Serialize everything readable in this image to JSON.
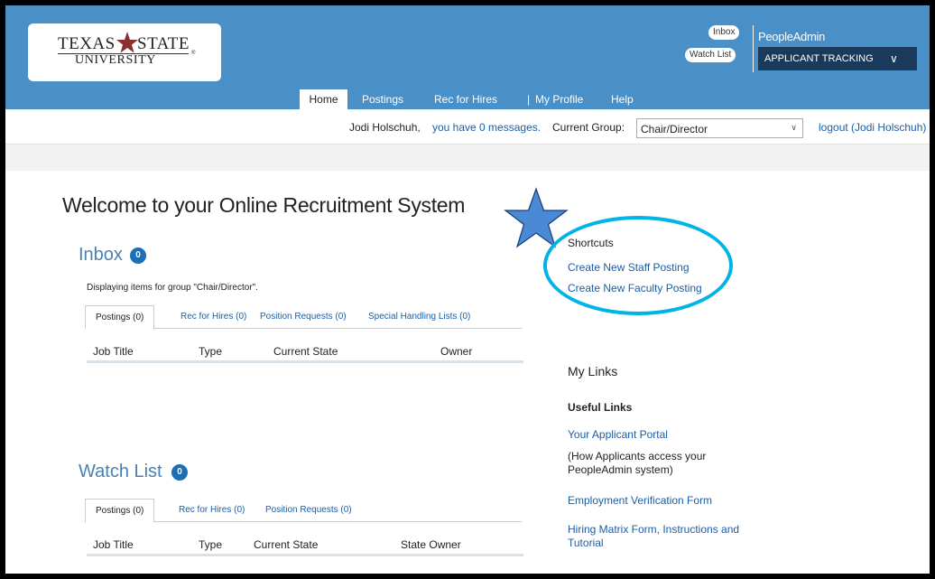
{
  "header": {
    "logo": {
      "line1_left": "TEXAS",
      "line1_right": "STATE",
      "line2": "UNIVERSITY",
      "mark": "®"
    },
    "inbox_label": "Inbox",
    "watchlist_label": "Watch List",
    "brand": "PeopleAdmin",
    "module_dropdown": "APPLICANT TRACKING",
    "accent": "#4a90c8",
    "dropdown_bg": "#1a3a5c"
  },
  "nav": {
    "items": [
      {
        "label": "Home",
        "active": true
      },
      {
        "label": "Postings"
      },
      {
        "label": "Rec for Hires"
      },
      {
        "label": "|"
      },
      {
        "label": "My Profile"
      },
      {
        "label": "Help"
      }
    ]
  },
  "userbar": {
    "name": "Jodi Holschuh,",
    "messages": "you have 0 messages.",
    "group_label": "Current Group:",
    "group_value": "Chair/Director",
    "logout": "logout (Jodi Holschuh)"
  },
  "main": {
    "welcome": "Welcome to your Online Recruitment System",
    "inbox": {
      "title": "Inbox",
      "count": "0",
      "note": "Displaying items for group \"Chair/Director\".",
      "tabs": [
        "Postings (0)",
        "Rec for Hires (0)",
        "Position Requests (0)",
        "Special Handling Lists (0)"
      ],
      "columns": [
        "Job Title",
        "Type",
        "Current State",
        "Owner"
      ]
    },
    "watchlist": {
      "title": "Watch List",
      "count": "0",
      "tabs": [
        "Postings (0)",
        "Rec for Hires (0)",
        "Position Requests (0)"
      ],
      "columns": [
        "Job Title",
        "Type",
        "Current State",
        "State Owner"
      ]
    }
  },
  "sidebar": {
    "shortcuts_title": "Shortcuts",
    "shortcuts": [
      "Create New Staff Posting",
      "Create New Faculty Posting"
    ],
    "mylinks_title": "My Links",
    "useful_title": "Useful Links",
    "links": {
      "portal": "Your Applicant Portal",
      "portal_note": "(How Applicants access your PeopleAdmin system)",
      "verification": "Employment Verification Form",
      "matrix": "Hiring Matrix Form, Instructions and Tutorial"
    }
  },
  "annotations": {
    "star_color": "#4a8ad4",
    "oval_color": "#00b4e6",
    "icons": [
      "star-annotation-icon",
      "circle-annotation"
    ]
  }
}
